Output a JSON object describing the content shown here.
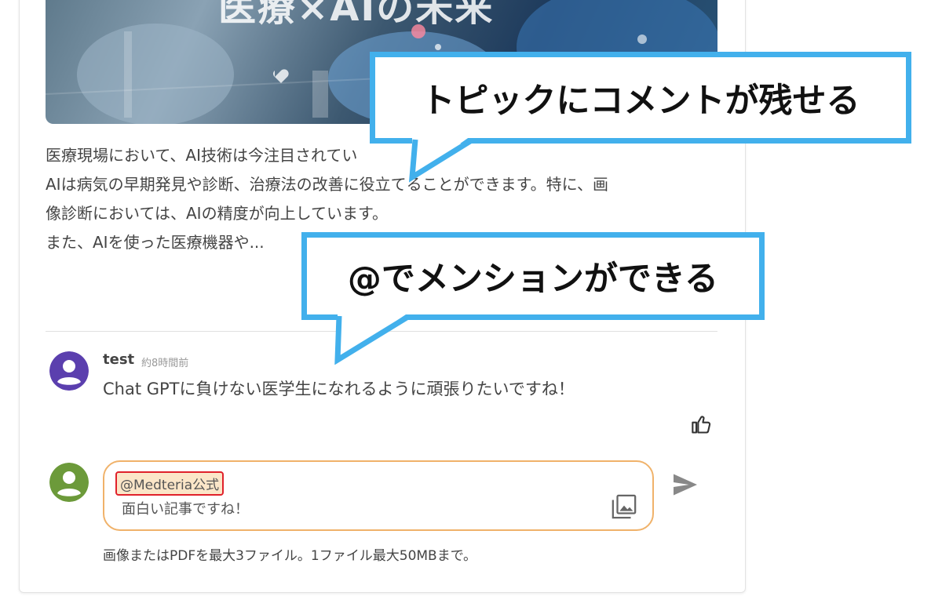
{
  "hero": {
    "title": "医療×AIの未来"
  },
  "article": {
    "lines": [
      "医療現場において、AI技術は今注目されてい",
      "AIは病気の早期発見や診断、治療法の改善に役立てることができます。特に、画",
      "像診断においては、AIの精度が向上しています。",
      "また、AIを使った医療機器や..."
    ]
  },
  "comment": {
    "author": "test",
    "time": "約8時間前",
    "body": "Chat GPTに負けない医学生になれるように頑張りたいですね！",
    "avatar_color": "#5b3fae"
  },
  "composer": {
    "mention": "@Medteria公式",
    "text": "面白い記事ですね！",
    "border_color": "#f0b26a",
    "avatar_color": "#6c9a3a"
  },
  "upload_note": "画像またはPDFを最大3ファイル。1ファイル最大50MBまで。",
  "callouts": {
    "comment_feature": "トピックにコメントが残せる",
    "mention_feature": "@でメンションができる",
    "border_color": "#42b0ec"
  },
  "icons": {
    "like": "thumbs-up-icon",
    "image": "image-icon",
    "send": "send-icon",
    "avatar": "person-icon"
  }
}
